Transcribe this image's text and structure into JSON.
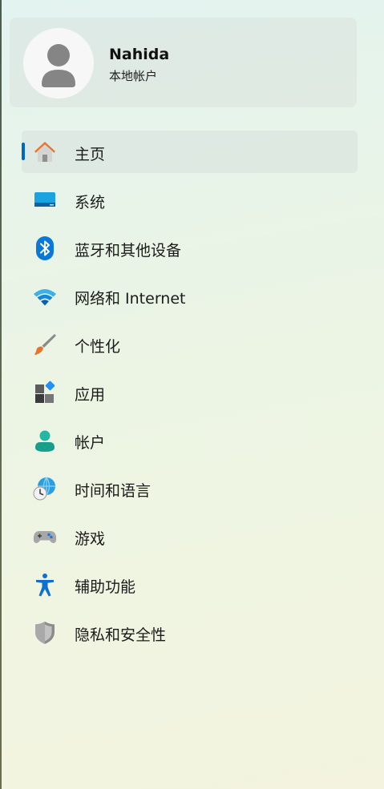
{
  "account": {
    "name": "Nahida",
    "type": "本地帐户",
    "avatar_icon": "person-avatar-icon"
  },
  "nav": {
    "selected_index": 0,
    "accent_color": "#0067c0",
    "items": [
      {
        "label": "主页",
        "icon": "home-icon"
      },
      {
        "label": "系统",
        "icon": "system-display-icon"
      },
      {
        "label": "蓝牙和其他设备",
        "icon": "bluetooth-icon"
      },
      {
        "label": "网络和 Internet",
        "icon": "wifi-network-icon"
      },
      {
        "label": "个性化",
        "icon": "paintbrush-icon"
      },
      {
        "label": "应用",
        "icon": "apps-icon"
      },
      {
        "label": "帐户",
        "icon": "account-person-icon"
      },
      {
        "label": "时间和语言",
        "icon": "time-language-globe-icon"
      },
      {
        "label": "游戏",
        "icon": "gamepad-icon"
      },
      {
        "label": "辅助功能",
        "icon": "accessibility-icon"
      },
      {
        "label": "隐私和安全性",
        "icon": "shield-icon"
      }
    ]
  }
}
